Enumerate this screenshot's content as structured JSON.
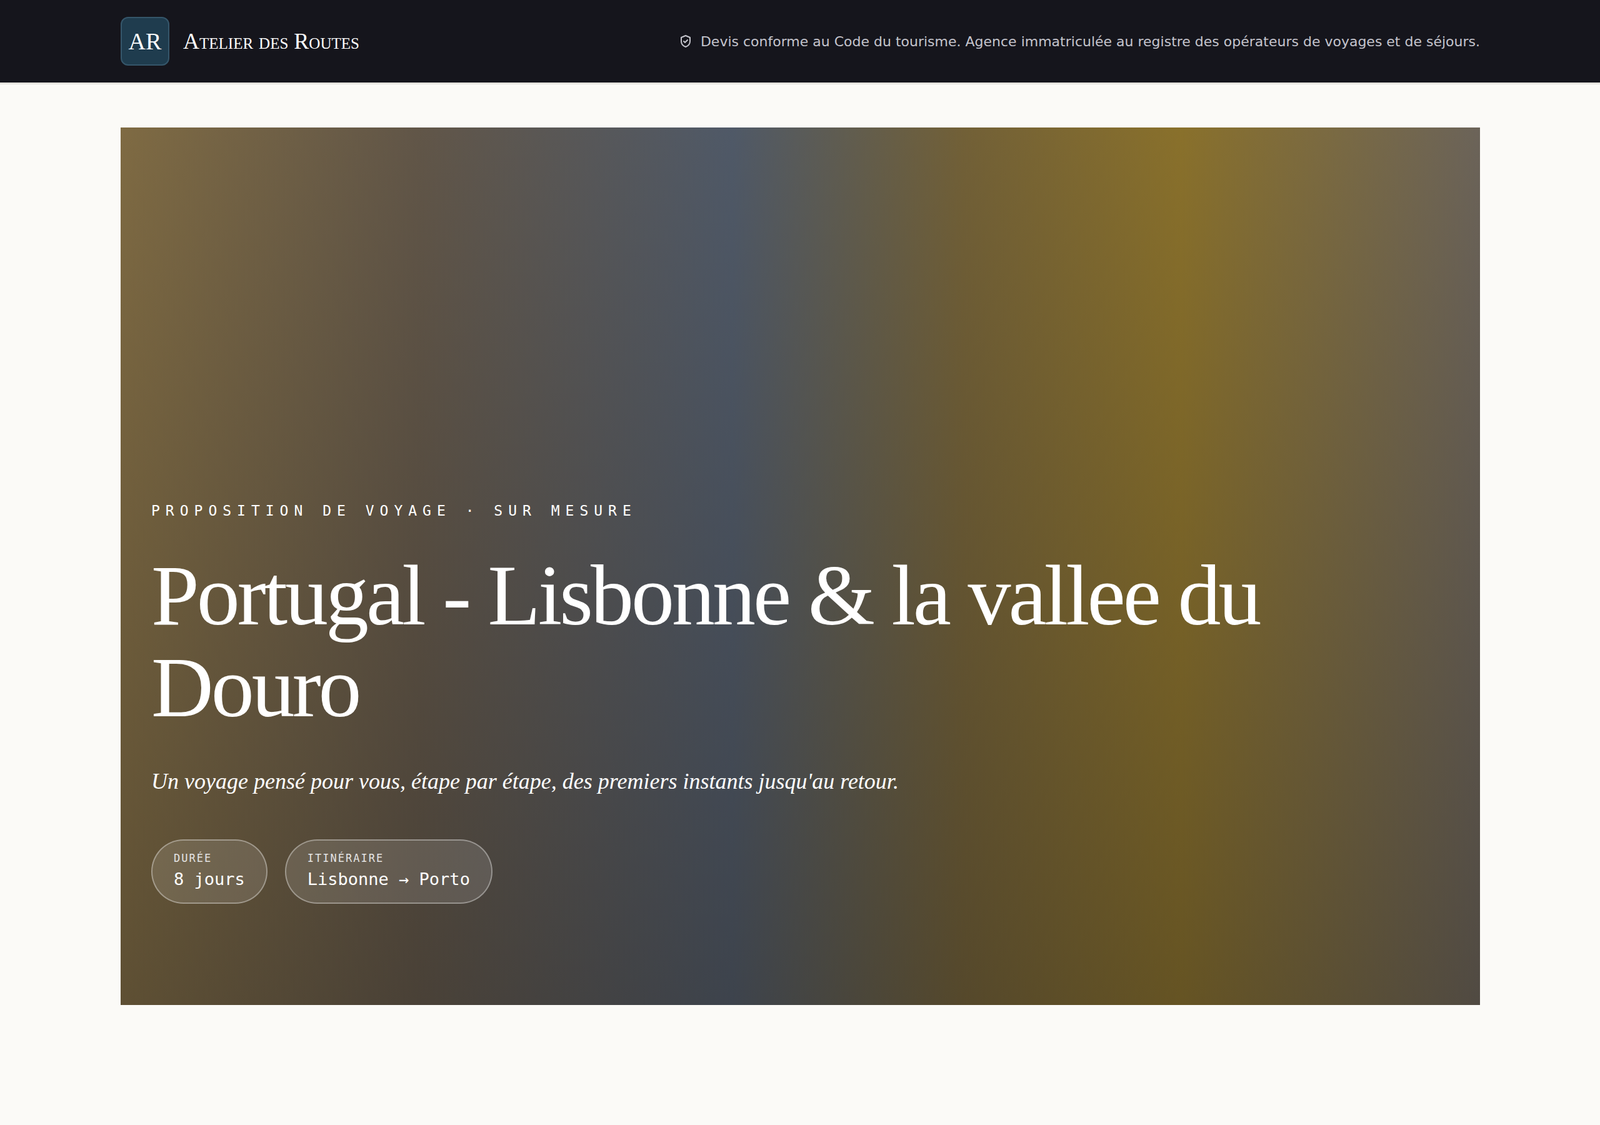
{
  "header": {
    "logo": "AR",
    "brand": "Atelier des Routes",
    "notice": "Devis conforme au Code du tourisme. Agence immatriculée au registre des opérateurs de voyages et de séjours."
  },
  "hero": {
    "eyebrow": "PROPOSITION DE VOYAGE · SUR MESURE",
    "title": "Portugal - Lisbonne & la vallee du Douro",
    "subtitle": "Un voyage pensé pour vous, étape par étape, des premiers instants jusqu'au retour.",
    "facts": [
      {
        "label": "DURÉE",
        "value": "8 jours"
      },
      {
        "label": "ITINÉRAIRE",
        "value": "Lisbonne → Porto"
      }
    ]
  }
}
